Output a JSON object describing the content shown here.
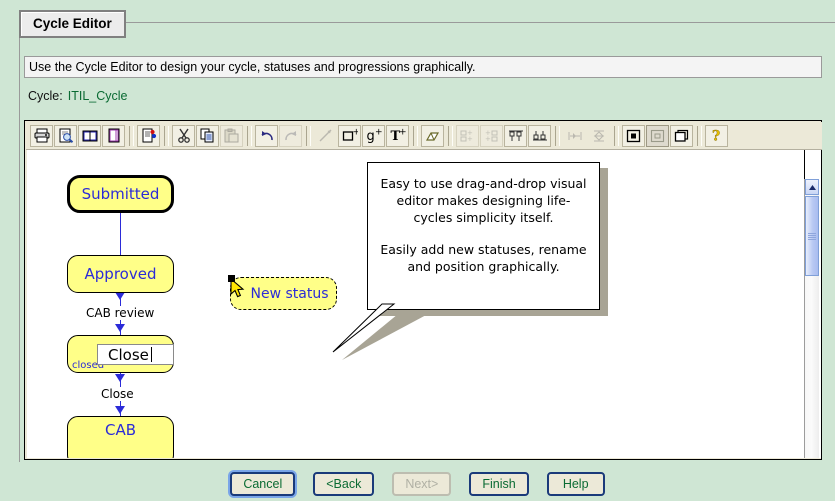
{
  "tab": {
    "label": "Cycle Editor"
  },
  "instruction": {
    "text": "Use the Cycle Editor to design your cycle, statuses and progressions graphically."
  },
  "cycle": {
    "label": "Cycle:",
    "value": "ITIL_Cycle"
  },
  "toolbar": {
    "buttons": [
      {
        "name": "print-icon",
        "title": "Print"
      },
      {
        "name": "print-preview-icon",
        "title": "Print Preview"
      },
      {
        "name": "book-icon",
        "title": "Open Catalog"
      },
      {
        "name": "page-icon",
        "title": "New Page"
      },
      {
        "name": "properties-icon",
        "title": "Properties"
      },
      {
        "name": "cut-icon",
        "title": "Cut"
      },
      {
        "name": "copy-icon",
        "title": "Copy"
      },
      {
        "name": "paste-icon",
        "title": "Paste"
      },
      {
        "name": "undo-icon",
        "title": "Undo"
      },
      {
        "name": "redo-icon",
        "title": "Redo"
      },
      {
        "name": "connector-icon",
        "title": "Draw Progression"
      },
      {
        "name": "add-status-icon",
        "title": "Add Status"
      },
      {
        "name": "add-group-icon",
        "title": "Add Group"
      },
      {
        "name": "add-text-icon",
        "title": "Add Text"
      },
      {
        "name": "eraser-icon",
        "title": "Erase"
      },
      {
        "name": "align-left-icon",
        "title": "Align Left"
      },
      {
        "name": "align-right-icon",
        "title": "Align Right"
      },
      {
        "name": "align-top-icon",
        "title": "Align Top"
      },
      {
        "name": "align-bottom-icon",
        "title": "Align Bottom"
      },
      {
        "name": "distribute-horizontal-icon",
        "title": "Distribute Horizontally"
      },
      {
        "name": "distribute-vertical-icon",
        "title": "Distribute Vertically"
      },
      {
        "name": "zoom-in-icon",
        "title": "Zoom In"
      },
      {
        "name": "zoom-out-icon",
        "title": "Zoom Out"
      },
      {
        "name": "zoom-fit-icon",
        "title": "Fit to Window"
      },
      {
        "name": "help-icon",
        "title": "Help"
      }
    ]
  },
  "diagram": {
    "nodes": [
      {
        "label": "Submitted",
        "substatus": ""
      },
      {
        "label": "Approved",
        "substatus": ""
      },
      {
        "label": "",
        "substatus": "closed"
      },
      {
        "label": "CAB",
        "substatus": ""
      },
      {
        "label": "New status",
        "substatus": ""
      }
    ],
    "edge_labels": [
      "CAB review",
      "Close"
    ],
    "inline_editor": {
      "value": "Close"
    }
  },
  "callout": {
    "paragraph1": "Easy to use drag-and-drop visual editor makes designing life-cycles simplicity itself.",
    "paragraph2": "Easily add new statuses, rename and position graphically."
  },
  "scrollbar": {
    "up_arrow": "▲"
  },
  "footer": {
    "buttons": [
      {
        "label": "Cancel",
        "state": "focused"
      },
      {
        "label": "<Back",
        "state": "normal"
      },
      {
        "label": "Next>",
        "state": "disabled"
      },
      {
        "label": "Finish",
        "state": "normal"
      },
      {
        "label": "Help",
        "state": "normal"
      }
    ]
  },
  "colors": {
    "page_background": "#cfe6d4",
    "node_fill": "#ffff88",
    "node_text": "#2b2bd8",
    "button_text": "#0a6b33",
    "button_border": "#1a3a7a",
    "toolbar_background": "#ece9d8"
  }
}
